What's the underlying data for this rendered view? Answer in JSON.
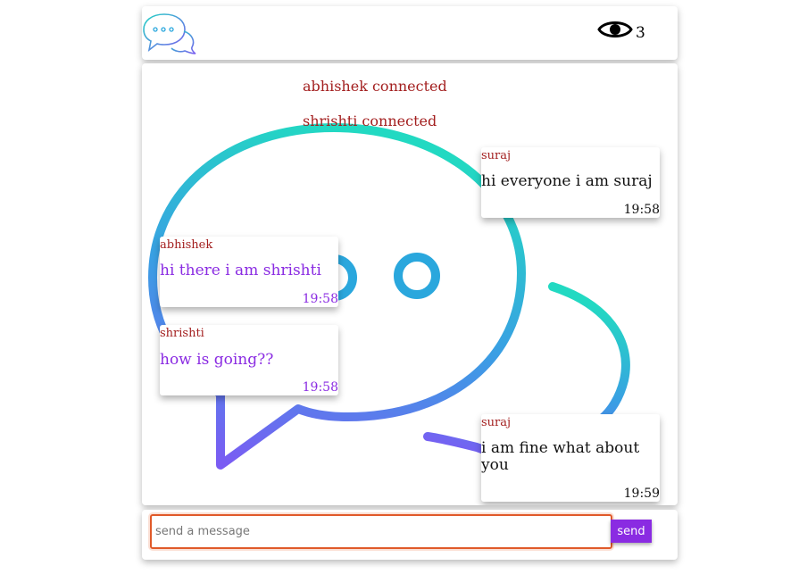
{
  "header": {
    "logo_icon": "chat-bubbles-logo",
    "viewers_icon": "eye-icon",
    "viewers_count": "3"
  },
  "chat": {
    "background_icon": "chat-bubbles-illustration",
    "notices": [
      "abhishek connected",
      "shrishti connected"
    ],
    "messages": [
      {
        "author": "suraj",
        "text": "hi everyone i am suraj",
        "time": "19:58",
        "side": "right"
      },
      {
        "author": "abhishek",
        "text": "hi there i am shrishti",
        "time": "19:58",
        "side": "left"
      },
      {
        "author": "shrishti",
        "text": "how is going??",
        "time": "19:58",
        "side": "left"
      },
      {
        "author": "suraj",
        "text": "i am fine what about you",
        "time": "19:59",
        "side": "right"
      }
    ]
  },
  "composer": {
    "placeholder": "send a message",
    "send_label": "send"
  },
  "colors": {
    "accent": "#8a2be2",
    "author": "#a31f1f",
    "input_border": "#e05a2a"
  }
}
